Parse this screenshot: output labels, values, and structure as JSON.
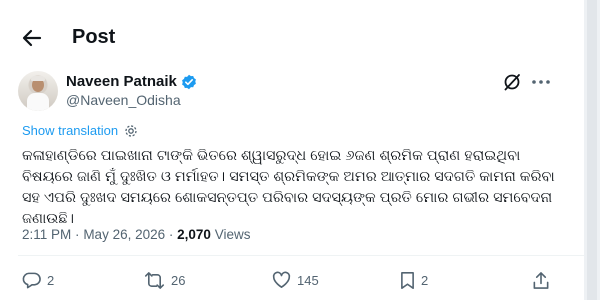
{
  "header": {
    "title": "Post",
    "back_icon": "arrow-left-icon"
  },
  "author": {
    "name": "Naveen Patnaik",
    "handle": "@Naveen_Odisha",
    "verified_color": "#1d9bf0"
  },
  "translate": {
    "label": "Show translation"
  },
  "tweet": {
    "text": "କଳାହାଣ୍ଡିରେ ପାଇଖାନା ଟାଙ୍କି ଭିତରେ ଶ୍ୱାସରୁଦ୍ଧ ହୋଇ ୬ଜଣ ଶ୍ରମିକ ପ୍ରାଣ ହରାଇଥିବା ବିଷୟରେ ଜାଣି ମୁଁ ଦୁଃଖିତ ଓ ମର୍ମାହତ। ସମସ୍ତ ଶ୍ରମିକଙ୍କ ଅମର ଆତ୍ମାର ସଦଗତି କାମନା କରିବା ସହ ଏପରି ଦୁଃଖଦ ସମୟରେ ଶୋକସନ୍ତପ୍ତ ପରିବାର ସଦସ୍ୟଙ୍କ ପ୍ରତି ମୋର ଗଭୀର ସମବେଦନା ଜଣାଉଛି।"
  },
  "meta": {
    "time": "2:11 PM",
    "date": "May 26, 2026",
    "views_count": "2,070",
    "views_label": "Views",
    "sep": "·"
  },
  "actions": {
    "replies": "2",
    "reposts": "26",
    "likes": "145",
    "bookmarks": "2"
  },
  "colors": {
    "accent": "#1d9bf0",
    "secondary_text": "#536471"
  }
}
